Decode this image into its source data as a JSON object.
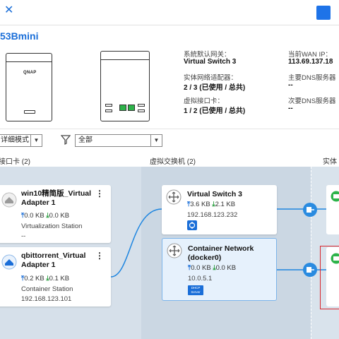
{
  "device": {
    "title": "53Bmini",
    "front_logo": "QNAP"
  },
  "info": {
    "col1": [
      {
        "label": "系統默认网关：",
        "value": "Virtual Switch 3"
      },
      {
        "label": "实体网络适配器：",
        "value": "2 / 3 (已使用 / 总共)"
      },
      {
        "label": "虚拟接口卡：",
        "value": "1 / 2 (已使用 / 总共)"
      }
    ],
    "col2": [
      {
        "label": "当前WAN IP：",
        "value": "113.69.137.18"
      },
      {
        "label": "主要DNS服务器",
        "value": "--"
      },
      {
        "label": "次要DNS服务器",
        "value": "--"
      }
    ]
  },
  "filters": {
    "view_mode": "详细模式",
    "scope": "全部"
  },
  "sections": {
    "left": "接口卡 (2)",
    "mid": "虚拟交换机 (2)",
    "right": "实体"
  },
  "adapters": [
    {
      "name": "win10精简版_Virtual Adapter 1",
      "up": "0.0 KB",
      "down": "0.0 KB",
      "source": "Virtualization Station",
      "ip": "--"
    },
    {
      "name": "qbittorrent_Virtual Adapter 1",
      "up": "0.2 KB",
      "down": "0.1 KB",
      "source": "Container Station",
      "ip": "192.168.123.101"
    }
  ],
  "switches": [
    {
      "name": "Virtual Switch 3",
      "up": "3.6 KB",
      "down": "2.1 KB",
      "ip": "192.168.123.232"
    },
    {
      "name": "Container Network (docker0)",
      "up": "0.0 KB",
      "down": "0.0 KB",
      "ip": "10.0.5.1",
      "badge": "DHCP Server"
    }
  ],
  "menu_glyph": "⋮",
  "colors": {
    "accent": "#1a6ed8",
    "selected_border": "#7cb4ea",
    "highlight_box": "#d9262c",
    "port_green": "#2db34a"
  }
}
